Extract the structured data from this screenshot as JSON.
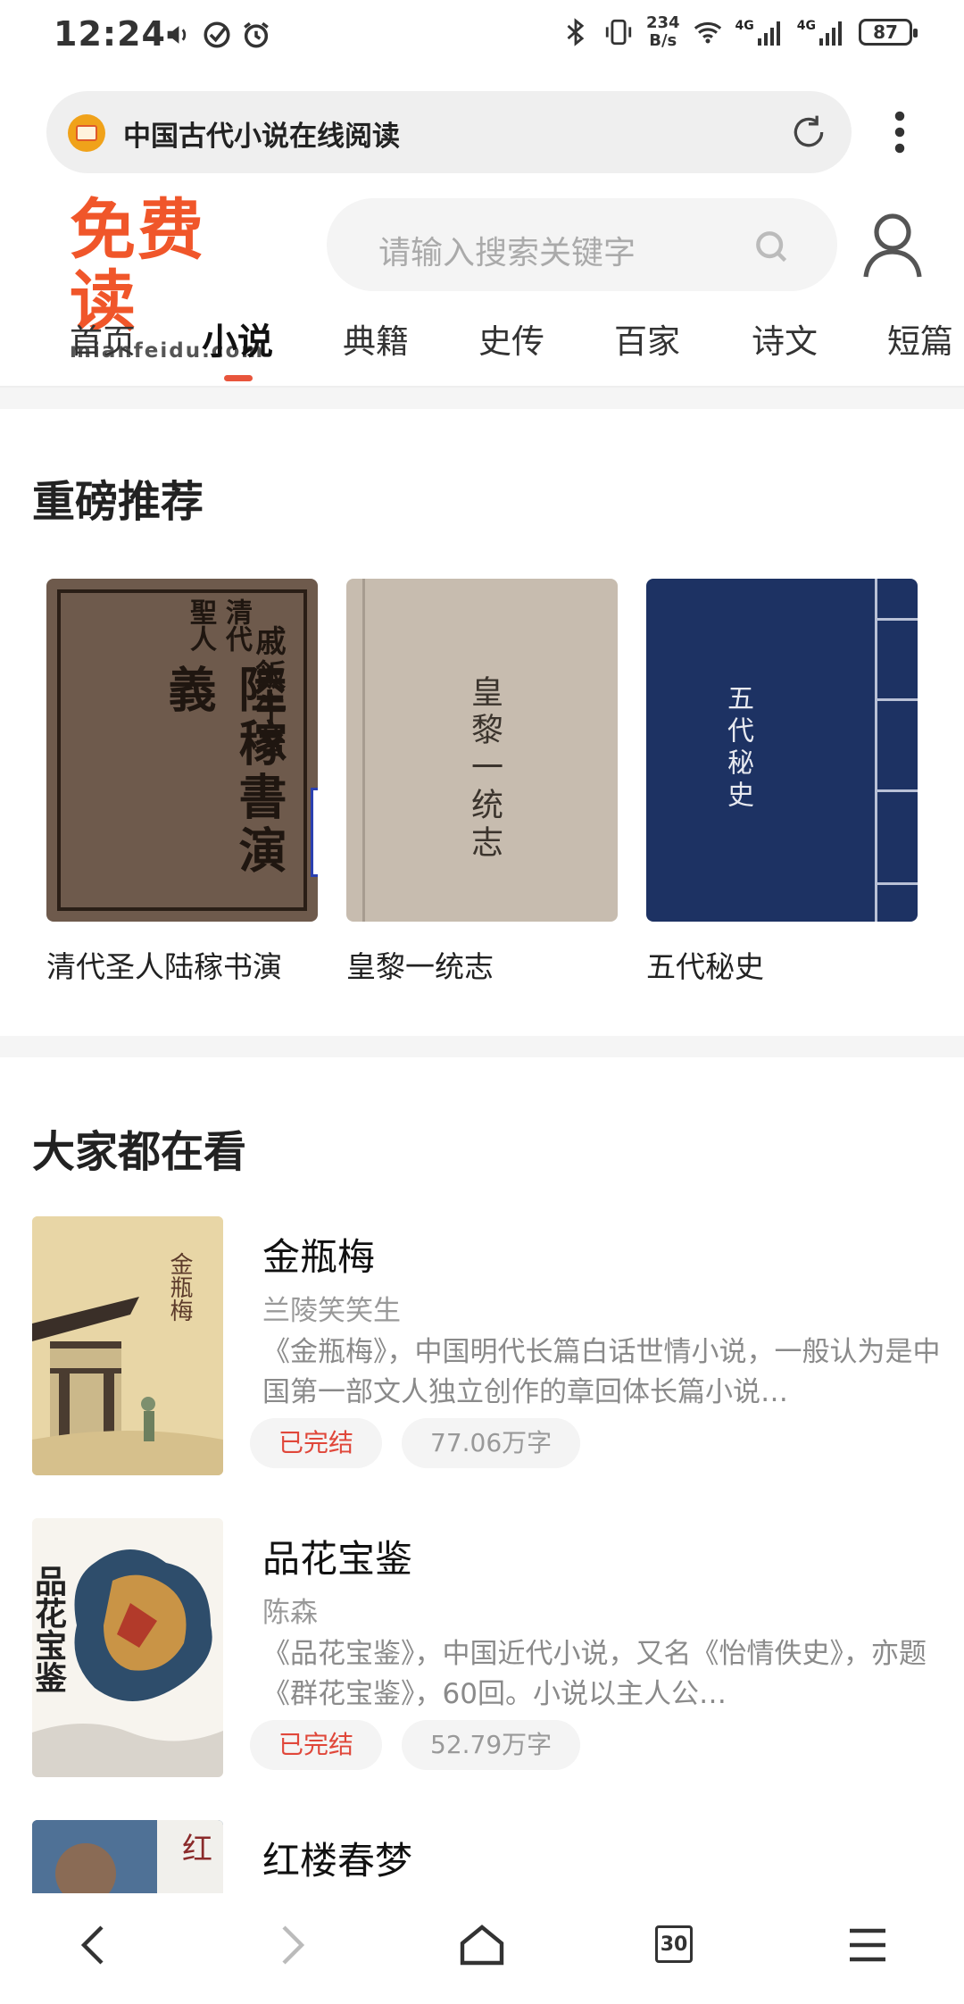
{
  "status_bar": {
    "time": "12:24",
    "net_speed_value": "234",
    "net_speed_unit": "B/s",
    "signal_1": "4G",
    "signal_2": "4G",
    "battery": "87"
  },
  "address_bar": {
    "page_title": "中国古代小说在线阅读"
  },
  "header": {
    "logo_text": "免费读",
    "logo_domain": "mianfeidu.com",
    "search_placeholder": "请输入搜索关键字"
  },
  "nav_tabs": [
    {
      "label": "首页"
    },
    {
      "label": "小说",
      "active": true
    },
    {
      "label": "典籍"
    },
    {
      "label": "史传"
    },
    {
      "label": "百家"
    },
    {
      "label": "诗文"
    },
    {
      "label": "短篇"
    }
  ],
  "featured": {
    "title": "重磅推荐",
    "books": [
      {
        "title": "清代圣人陆稼书演",
        "cover_text": [
          "清代",
          "聖人",
          "陸稼書演義",
          "戚飯牛著"
        ]
      },
      {
        "title": "皇黎一统志",
        "cover_text": "皇黎一统志"
      },
      {
        "title": "五代秘史",
        "cover_text": "五代秘史"
      }
    ]
  },
  "popular": {
    "title": "大家都在看",
    "items": [
      {
        "title": "金瓶梅",
        "author": "兰陵笑笑生",
        "desc": "《金瓶梅》，中国明代长篇白话世情小说，一般认为是中国第一部文人独立创作的章回体长篇小说…",
        "status": "已完结",
        "words": "77.06万字",
        "cover_text": "金瓶梅"
      },
      {
        "title": "品花宝鉴",
        "author": "陈森",
        "desc": "《品花宝鉴》，中国近代小说，又名《怡情佚史》，亦题《群花宝鉴》，60回。小说以主人公…",
        "status": "已完结",
        "words": "52.79万字",
        "cover_text": "品花宝鉴"
      },
      {
        "title": "红楼春梦",
        "author": "",
        "desc": "",
        "status": "",
        "words": "",
        "cover_text": "红"
      }
    ]
  },
  "bottom_nav": {
    "tab_count": "30"
  },
  "colors": {
    "brand": "#f0562a",
    "accent_underline": "#e8553c",
    "completed_tag": "#e0473a"
  }
}
